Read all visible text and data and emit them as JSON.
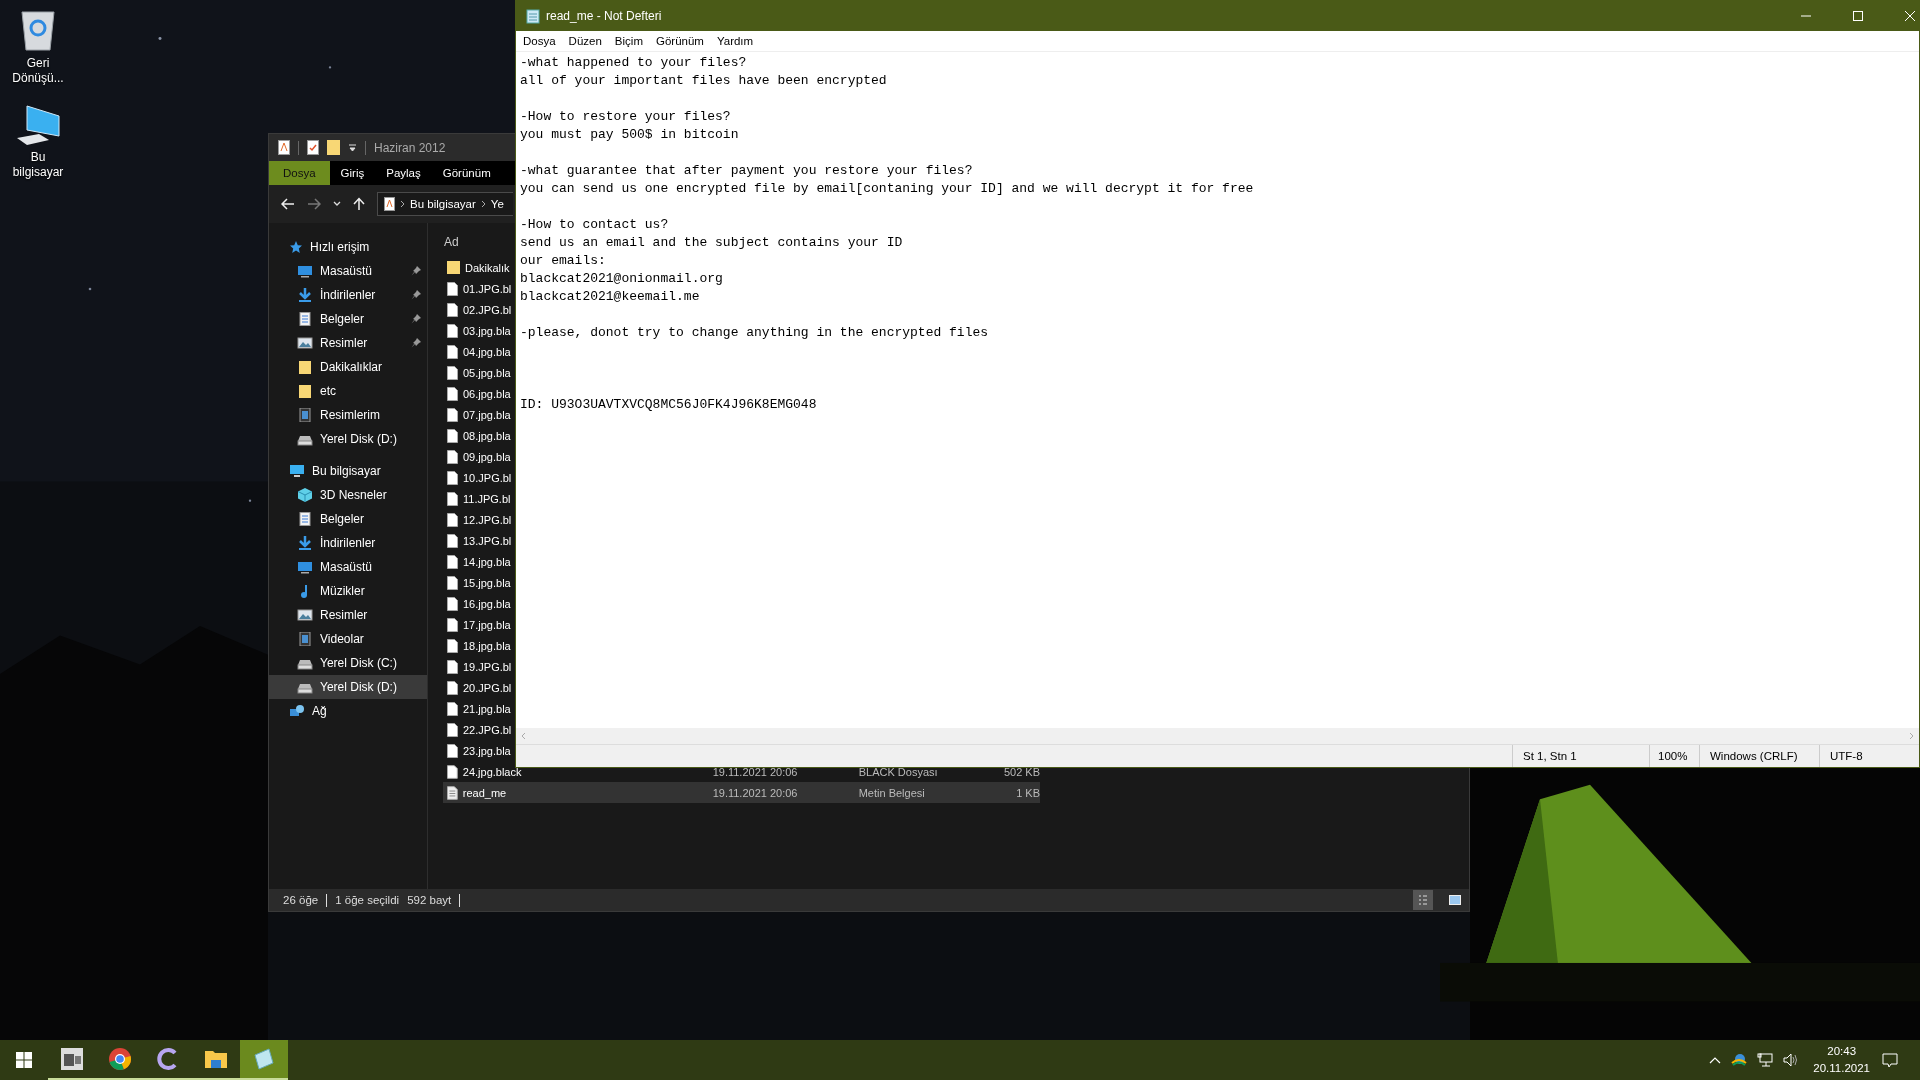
{
  "desktop_icons": [
    {
      "label": "Geri Dönüşü...",
      "kind": "recycle"
    },
    {
      "label": "Bu bilgisayar",
      "kind": "computer"
    }
  ],
  "explorer": {
    "title": "Haziran 2012",
    "ribbon_tabs": [
      {
        "label": "Dosya",
        "selected": true
      },
      {
        "label": "Giriş",
        "selected": false
      },
      {
        "label": "Paylaş",
        "selected": false
      },
      {
        "label": "Görünüm",
        "selected": false
      }
    ],
    "breadcrumb": [
      "Bu bilgisayar",
      "Ye"
    ],
    "nav": [
      {
        "label": "Hızlı erişim",
        "kind": "star",
        "selected": false,
        "children": [
          {
            "label": "Masaüstü",
            "kind": "desktop",
            "pinned": true,
            "selected": false
          },
          {
            "label": "İndirilenler",
            "kind": "download",
            "pinned": true,
            "selected": false
          },
          {
            "label": "Belgeler",
            "kind": "document",
            "pinned": true,
            "selected": false
          },
          {
            "label": "Resimler",
            "kind": "pictures",
            "pinned": true,
            "selected": false
          },
          {
            "label": "Dakikalıklar",
            "kind": "folder",
            "pinned": false,
            "selected": false
          },
          {
            "label": "etc",
            "kind": "folder",
            "pinned": false,
            "selected": false
          },
          {
            "label": "Resimlerim",
            "kind": "film",
            "pinned": false,
            "selected": false
          },
          {
            "label": "Yerel Disk (D:)",
            "kind": "drive",
            "pinned": false,
            "selected": false
          }
        ]
      },
      {
        "label": "Bu bilgisayar",
        "kind": "computer",
        "selected": false,
        "children": [
          {
            "label": "3D Nesneler",
            "kind": "cube",
            "pinned": false,
            "selected": false
          },
          {
            "label": "Belgeler",
            "kind": "document",
            "pinned": false,
            "selected": false
          },
          {
            "label": "İndirilenler",
            "kind": "download",
            "pinned": false,
            "selected": false
          },
          {
            "label": "Masaüstü",
            "kind": "desktop",
            "pinned": false,
            "selected": false
          },
          {
            "label": "Müzikler",
            "kind": "music",
            "pinned": false,
            "selected": false
          },
          {
            "label": "Resimler",
            "kind": "pictures",
            "pinned": false,
            "selected": false
          },
          {
            "label": "Videolar",
            "kind": "film",
            "pinned": false,
            "selected": false
          },
          {
            "label": "Yerel Disk (C:)",
            "kind": "drive",
            "pinned": false,
            "selected": false
          },
          {
            "label": "Yerel Disk (D:)",
            "kind": "drive",
            "pinned": false,
            "selected": true
          }
        ]
      },
      {
        "label": "Ağ",
        "kind": "network",
        "selected": false
      }
    ],
    "column": "Ad",
    "files": [
      {
        "name": "Dakikalık",
        "kind": "folder",
        "selected": false
      },
      {
        "name": "01.JPG.bl",
        "kind": "file",
        "selected": false
      },
      {
        "name": "02.JPG.bl",
        "kind": "file",
        "selected": false
      },
      {
        "name": "03.jpg.bla",
        "kind": "file",
        "selected": false
      },
      {
        "name": "04.jpg.bla",
        "kind": "file",
        "selected": false
      },
      {
        "name": "05.jpg.bla",
        "kind": "file",
        "selected": false
      },
      {
        "name": "06.jpg.bla",
        "kind": "file",
        "selected": false
      },
      {
        "name": "07.jpg.bla",
        "kind": "file",
        "selected": false
      },
      {
        "name": "08.jpg.bla",
        "kind": "file",
        "selected": false
      },
      {
        "name": "09.jpg.bla",
        "kind": "file",
        "selected": false
      },
      {
        "name": "10.JPG.bl",
        "kind": "file",
        "selected": false
      },
      {
        "name": "11.JPG.bl",
        "kind": "file",
        "selected": false
      },
      {
        "name": "12.JPG.bl",
        "kind": "file",
        "selected": false
      },
      {
        "name": "13.JPG.bl",
        "kind": "file",
        "selected": false
      },
      {
        "name": "14.jpg.bla",
        "kind": "file",
        "selected": false
      },
      {
        "name": "15.jpg.bla",
        "kind": "file",
        "selected": false
      },
      {
        "name": "16.jpg.bla",
        "kind": "file",
        "selected": false
      },
      {
        "name": "17.jpg.bla",
        "kind": "file",
        "selected": false
      },
      {
        "name": "18.jpg.bla",
        "kind": "file",
        "selected": false
      },
      {
        "name": "19.JPG.bl",
        "kind": "file",
        "selected": false
      },
      {
        "name": "20.JPG.bl",
        "kind": "file",
        "selected": false
      },
      {
        "name": "21.jpg.bla",
        "kind": "file",
        "selected": false
      },
      {
        "name": "22.JPG.bl",
        "kind": "file",
        "selected": false
      },
      {
        "name": "23.jpg.bla",
        "kind": "file",
        "selected": false
      },
      {
        "name": "24.jpg.black",
        "kind": "file",
        "date": "19.11.2021 20:06",
        "type": "BLACK Dosyası",
        "size": "502 KB",
        "selected": false
      },
      {
        "name": "read_me",
        "kind": "text",
        "date": "19.11.2021 20:06",
        "type": "Metin Belgesi",
        "size": "1 KB",
        "selected": true
      }
    ],
    "status": [
      "26 öğe",
      "1 öğe seçildi",
      "592 bayt"
    ],
    "view_modes": [
      {
        "kind": "details",
        "selected": true
      },
      {
        "kind": "tiles",
        "selected": false
      }
    ]
  },
  "notepad": {
    "title": "read_me - Not Defteri",
    "menu": [
      "Dosya",
      "Düzen",
      "Biçim",
      "Görünüm",
      "Yardım"
    ],
    "text": "-what happened to your files?\nall of your important files have been encrypted\n\n-How to restore your files?\nyou must pay 500$ in bitcoin\n\n-what guarantee that after payment you restore your files?\nyou can send us one encrypted file by email[contaning your ID] and we will decrypt it for free\n\n-How to contact us?\nsend us an email and the subject contains your ID\nour emails:\nblackcat2021@onionmail.org\nblackcat2021@keemail.me\n\n-please, donot try to change anything in the encrypted files\n\n\n\nID: U93O3UAVTXVCQ8MC56J0FK4J96K8EMG048",
    "status": [
      "St 1, Stn 1",
      "100%",
      "Windows (CRLF)",
      "UTF-8"
    ]
  },
  "taskbar": {
    "apps": [
      {
        "kind": "media",
        "running": true,
        "active": false
      },
      {
        "kind": "browser",
        "running": true,
        "active": false
      },
      {
        "kind": "letter-c",
        "running": true,
        "active": false
      },
      {
        "kind": "folder",
        "running": true,
        "active": false
      },
      {
        "kind": "notepad",
        "running": true,
        "active": true
      }
    ],
    "time": "20:43",
    "date": "20.11.2021"
  }
}
